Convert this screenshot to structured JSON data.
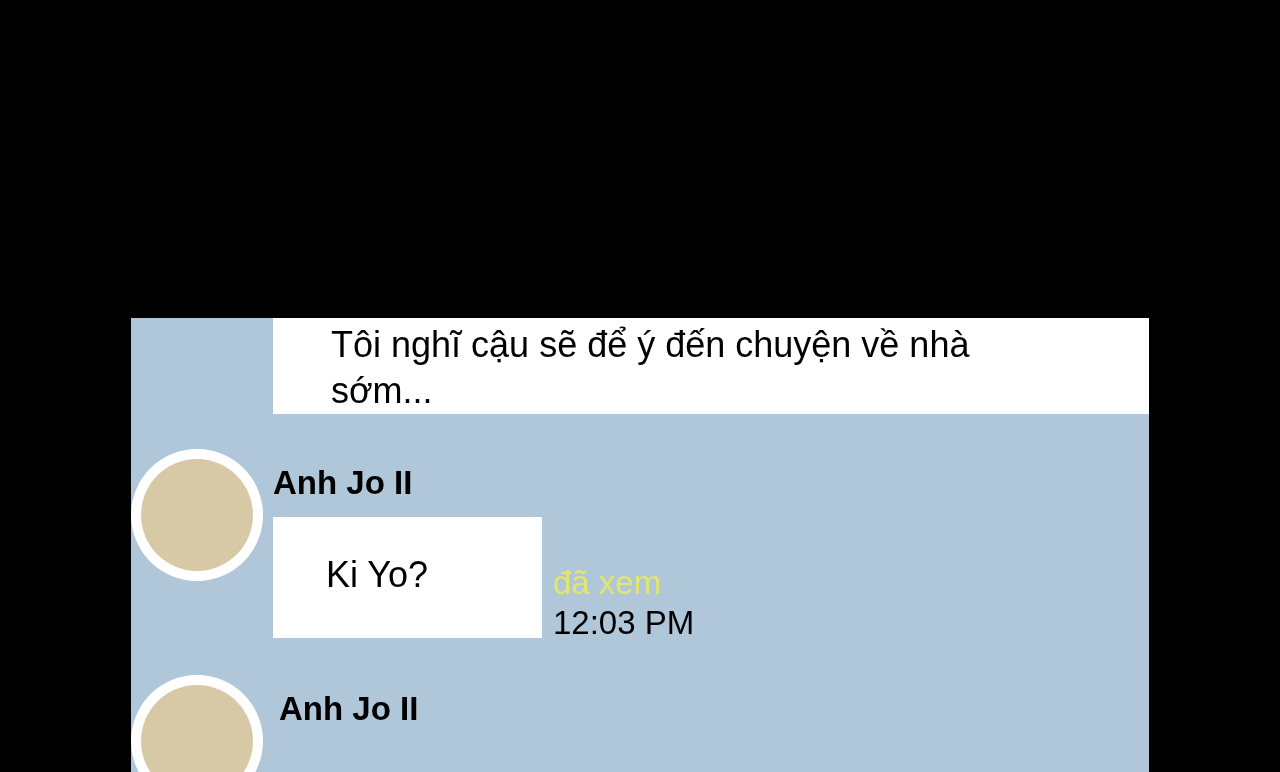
{
  "messages": [
    {
      "kind": "continued",
      "text": "Tôi nghĩ cậu sẽ để ý đến chuyện về nhà sớm..."
    },
    {
      "kind": "full",
      "sender": "Anh Jo II",
      "text": "Ki Yo?",
      "read_label": "đã xem",
      "time": "12:03 PM"
    },
    {
      "kind": "header",
      "sender": "Anh Jo II"
    }
  ]
}
